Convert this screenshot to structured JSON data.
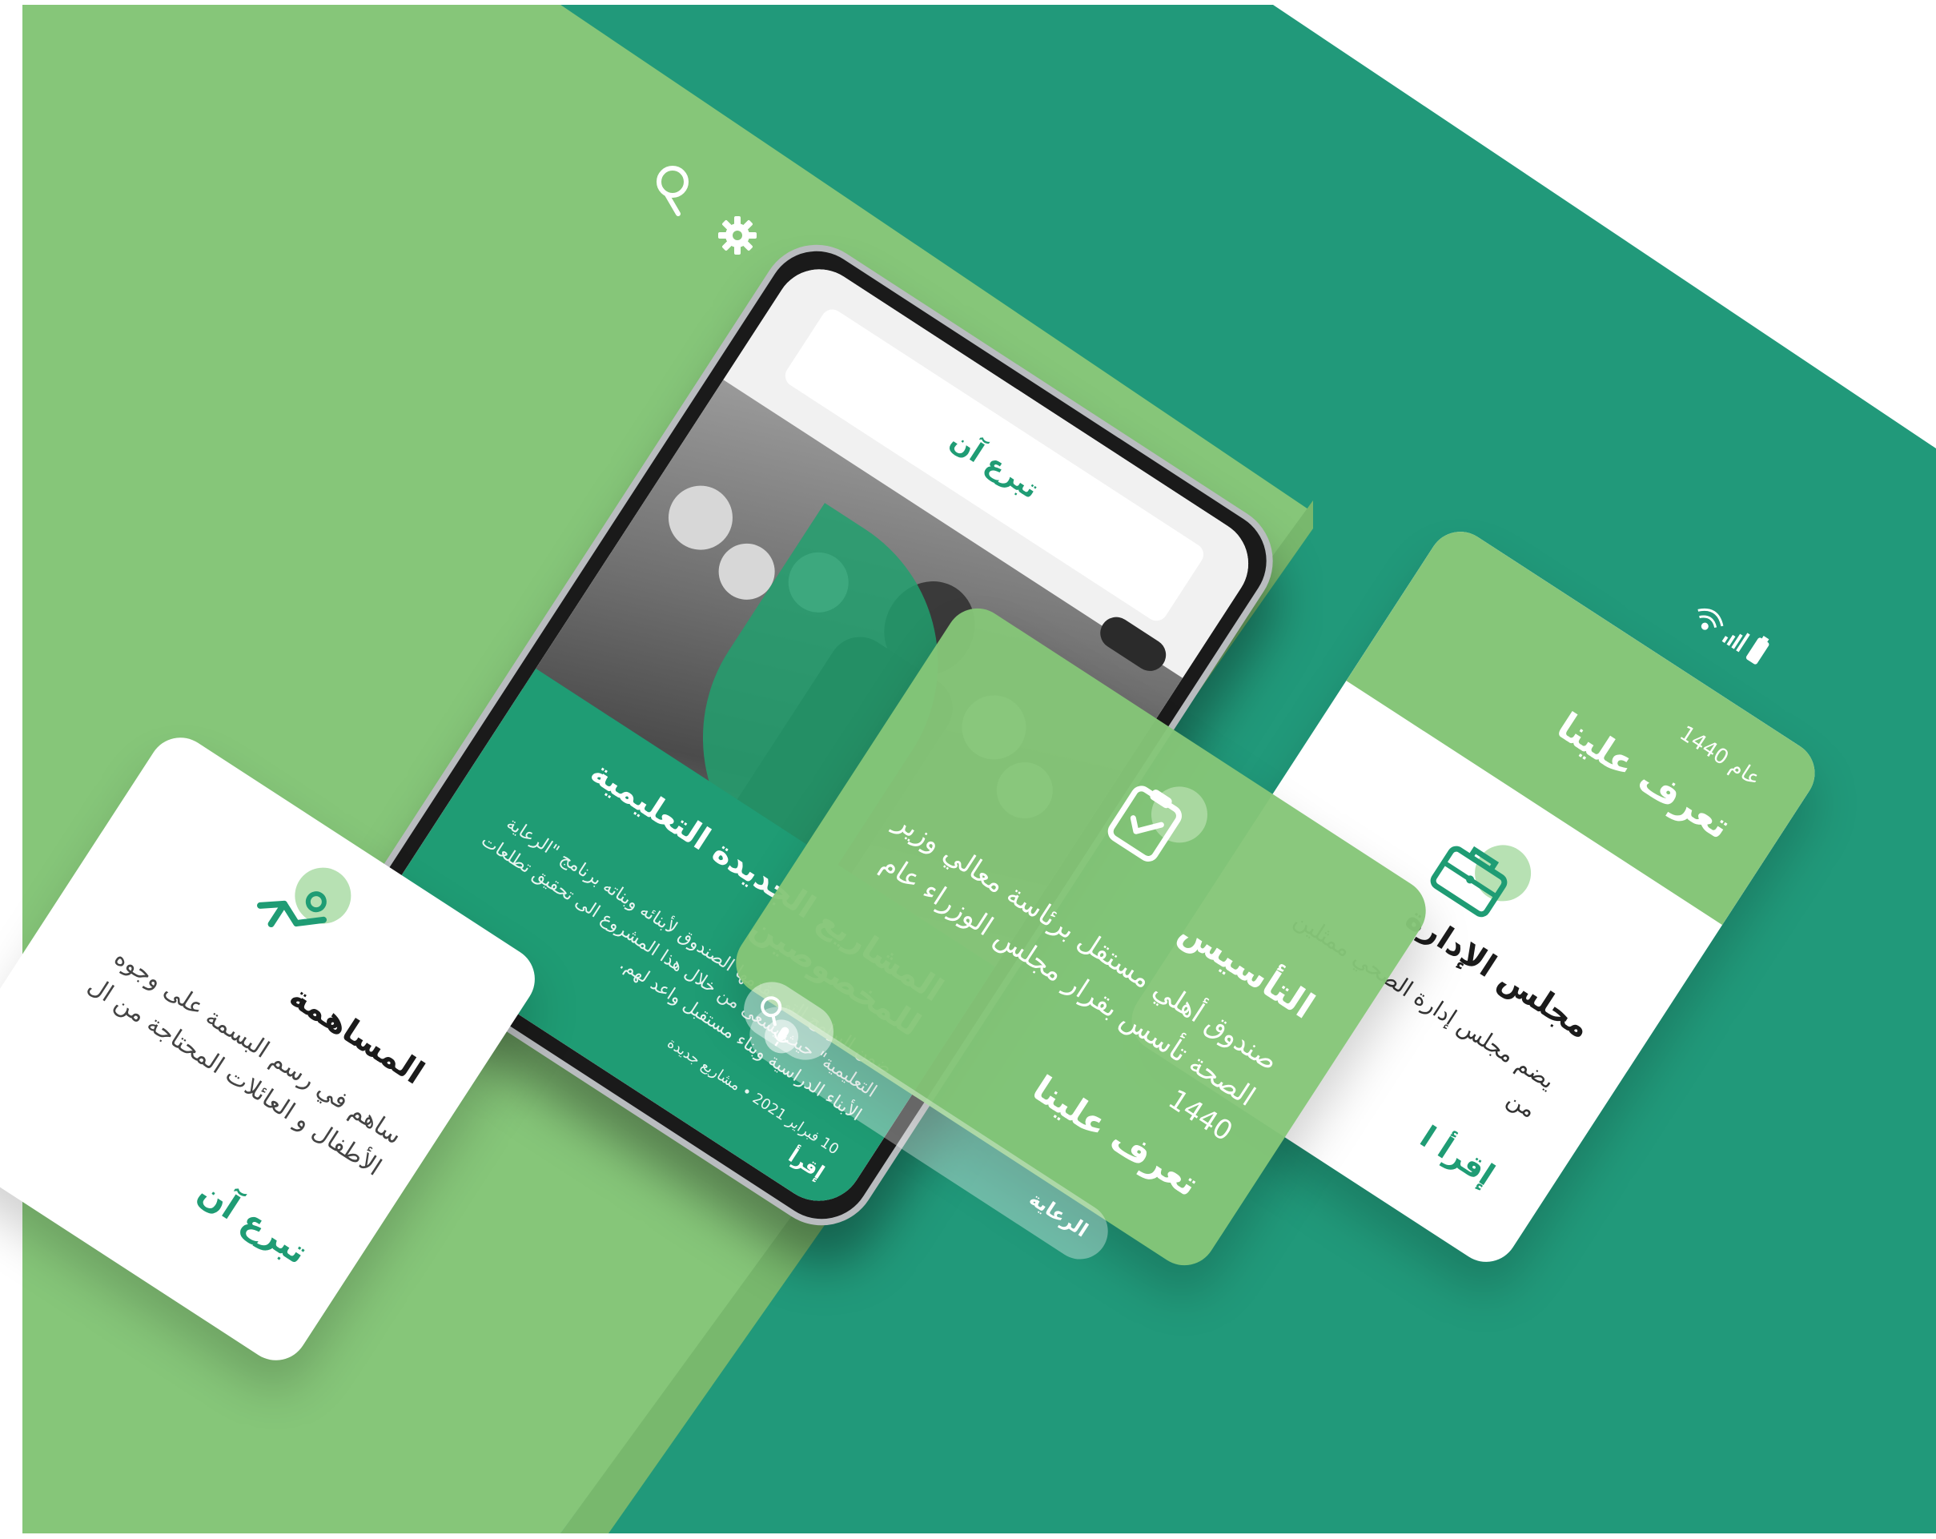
{
  "colors": {
    "light_green": "#86c679",
    "dark_green": "#21997a",
    "accent_green": "#1f9c74",
    "white": "#ffffff"
  },
  "icons": {
    "search": "search-icon",
    "settings": "gear-icon",
    "contribution": "donate-hand-icon",
    "founding": "clipboard-check-icon",
    "board": "board-briefcase-icon",
    "mic": "mic-icon",
    "wifi": "wifi-icon",
    "signal": "signal-icon",
    "battery": "battery-icon"
  },
  "phone": {
    "donate_button": "تبرع آن",
    "article": {
      "title": "المشاريع الجديدة التعليمية للمخصوصين",
      "body": "ضمن البرامج التي يقدمها الصندوق لأبنائه وبناته برنامج \"الرعاية التعليمية\" حيث يسعى من خلال هذا المشروع الى تحقيق تطلعات الأبناء الدراسية وبناء مستقبل واعد لهم.",
      "date": "10 فبراير 2021",
      "category": "مشاريع جديدة",
      "read_more": "إقرأ"
    }
  },
  "cards": {
    "contribution": {
      "title": "المساهمة",
      "body": "ساهم في رسم البسمة على وجوه الأطفال و العائلات المحتاجة من ال",
      "cta": "تبرع آن"
    },
    "founding": {
      "title": "التأسيس",
      "body": "صندوق أهلي مستقل برئاسة معالي وزير الصحة تأسس بقرار مجلس الوزراء عام 1440",
      "cta": "تعرف علينا"
    },
    "about": {
      "header_year": "عام 1440",
      "header_title": "تعرف علينا",
      "title": "مجلس الإدارة",
      "body": "يضم مجلس إدارة الصحي ممثلين من",
      "cta": "إقرأ ا"
    }
  },
  "search": {
    "label": "الرعاية"
  }
}
